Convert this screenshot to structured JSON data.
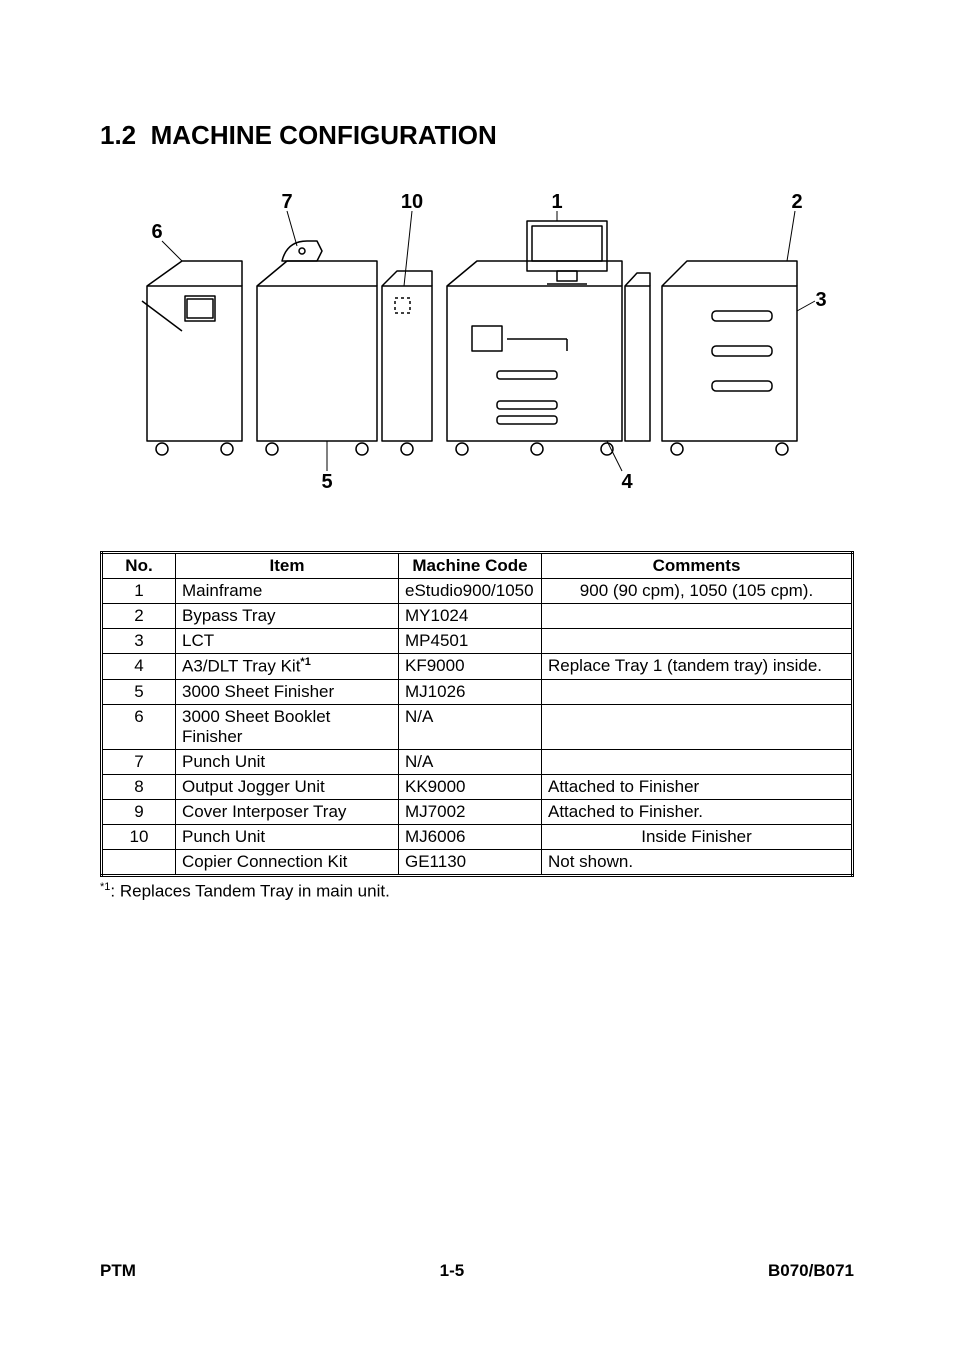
{
  "section": {
    "number": "1.2",
    "title": "MACHINE CONFIGURATION"
  },
  "diagram": {
    "callouts": [
      "6",
      "7",
      "5",
      "10",
      "1",
      "4",
      "2",
      "3"
    ]
  },
  "table": {
    "headers": {
      "no": "No.",
      "item": "Item",
      "code": "Machine Code",
      "comments": "Comments"
    },
    "rows": [
      {
        "no": "1",
        "item": "Mainframe",
        "sup": "",
        "code": "eStudio900/1050",
        "comments": "900 (90 cpm), 1050 (105 cpm)."
      },
      {
        "no": "2",
        "item": "Bypass Tray",
        "sup": "",
        "code": "MY1024",
        "comments": ""
      },
      {
        "no": "3",
        "item": "LCT",
        "sup": "",
        "code": "MP4501",
        "comments": ""
      },
      {
        "no": "4",
        "item": "A3/DLT Tray Kit",
        "sup": "*1",
        "code": "KF9000",
        "comments": "Replace Tray 1 (tandem tray) inside."
      },
      {
        "no": "5",
        "item": "3000 Sheet Finisher",
        "sup": "",
        "code": "MJ1026",
        "comments": ""
      },
      {
        "no": "6",
        "item": "3000 Sheet Booklet Finisher",
        "sup": "",
        "code": "N/A",
        "comments": ""
      },
      {
        "no": "7",
        "item": "Punch Unit",
        "sup": "",
        "code": "N/A",
        "comments": ""
      },
      {
        "no": "8",
        "item": "Output Jogger Unit",
        "sup": "",
        "code": "KK9000",
        "comments": "Attached to Finisher"
      },
      {
        "no": "9",
        "item": "Cover Interposer Tray",
        "sup": "",
        "code": "MJ7002",
        "comments": "Attached to Finisher."
      },
      {
        "no": "10",
        "item": "Punch Unit",
        "sup": "",
        "code": "MJ6006",
        "comments": "Inside Finisher"
      },
      {
        "no": "",
        "item": "Copier Connection Kit",
        "sup": "",
        "code": "GE1130",
        "comments": "Not shown."
      }
    ]
  },
  "footnote": {
    "marker": "*1",
    "text": ": Replaces Tandem Tray in main unit."
  },
  "footer": {
    "left": "PTM",
    "center": "1-5",
    "right": "B070/B071"
  }
}
